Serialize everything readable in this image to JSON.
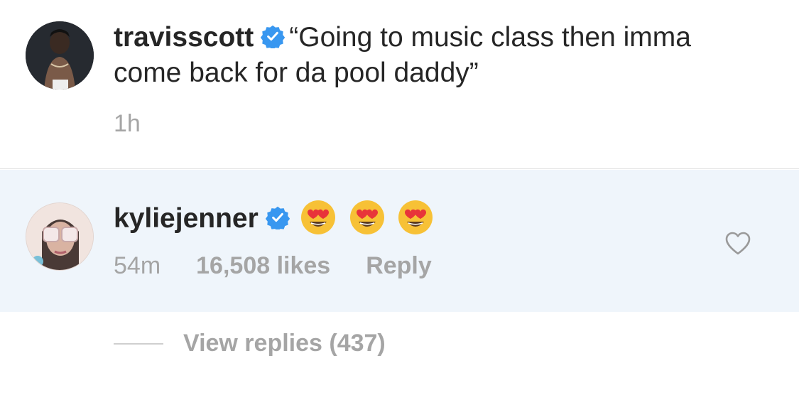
{
  "caption": {
    "username": "travisscott",
    "text_line1": "“Going to music class then imma",
    "text_line2": "come back for da pool daddy”",
    "time": "1h"
  },
  "comment": {
    "username": "kyliejenner",
    "emojis": [
      "heart-eyes-emoji",
      "heart-eyes-emoji",
      "heart-eyes-emoji"
    ],
    "time": "54m",
    "likes": "16,508 likes",
    "reply_label": "Reply"
  },
  "view_replies": {
    "label": "View replies (437)"
  },
  "colors": {
    "verified_blue": "#3897f0",
    "reply_bg": "#eff5fb",
    "meta_gray": "#a5a5a5",
    "text_dark": "#262626"
  }
}
